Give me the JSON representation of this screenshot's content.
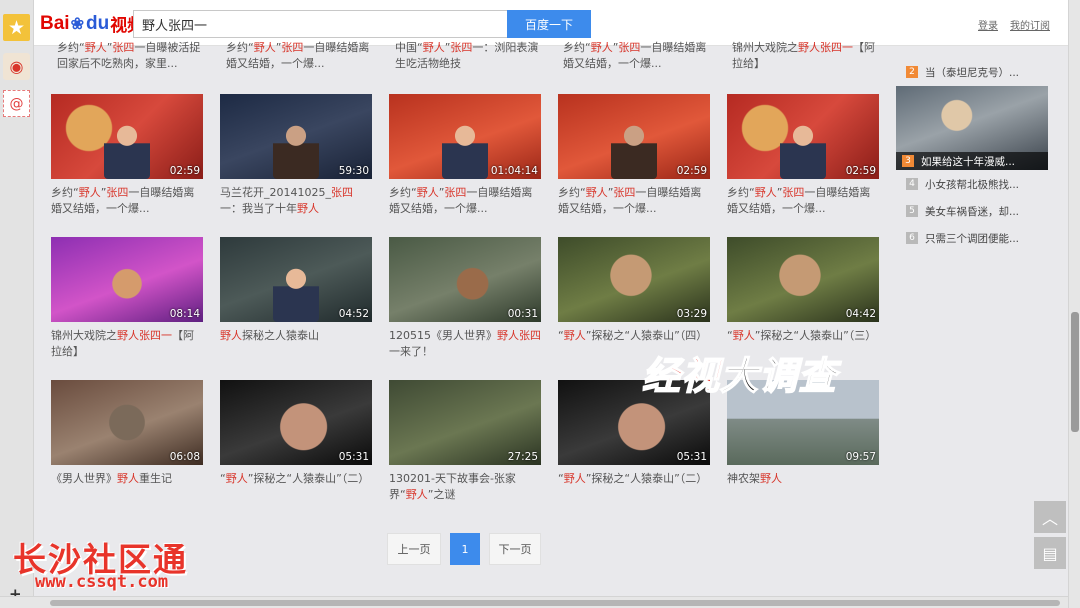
{
  "header": {
    "logo_bai": "Bai",
    "logo_du": "du",
    "logo_video": "视频",
    "search_value": "野人张四一",
    "search_button": "百度一下",
    "login": "登录",
    "subscriptions": "我的订阅"
  },
  "top_strip": [
    {
      "pre": "乡约“",
      "hl": "野人",
      "mid": "”",
      "hl2": "张四",
      "post": "一自曝被活捉回家后不吃熟肉，家里..."
    },
    {
      "pre": "乡约“",
      "hl": "野人",
      "mid": "”",
      "hl2": "张四",
      "post": "一自曝结婚离婚又结婚，一个爆..."
    },
    {
      "pre": "中国“",
      "hl": "野人",
      "mid": "”",
      "hl2": "张四",
      "post": "一：浏阳表演生吃活物绝技"
    },
    {
      "pre": "乡约“",
      "hl": "野人",
      "mid": "”",
      "hl2": "张四",
      "post": "一自曝结婚离婚又结婚，一个爆..."
    },
    {
      "pre": "锦州大戏院之",
      "hl": "野人张四",
      "mid": "",
      "hl2": "一",
      "post": "【阿拉给】"
    }
  ],
  "videos": [
    {
      "duration": "02:59",
      "caption_pre": "乡约“",
      "caption_hl": "野人",
      "caption_mid": "”",
      "caption_hl2": "张四",
      "caption_post": "一自曝结婚离婚又结婚，一个爆..."
    },
    {
      "duration": "59:30",
      "caption_pre": "马兰花开_20141025_",
      "caption_hl": "张四",
      "caption_mid": "一：我当了十年",
      "caption_hl2": "野人",
      "caption_post": ""
    },
    {
      "duration": "01:04:14",
      "caption_pre": "乡约“",
      "caption_hl": "野人",
      "caption_mid": "”",
      "caption_hl2": "张四",
      "caption_post": "一自曝结婚离婚又结婚，一个爆..."
    },
    {
      "duration": "02:59",
      "caption_pre": "乡约“",
      "caption_hl": "野人",
      "caption_mid": "”",
      "caption_hl2": "张四",
      "caption_post": "一自曝结婚离婚又结婚，一个爆..."
    },
    {
      "duration": "02:59",
      "caption_pre": "乡约“",
      "caption_hl": "野人",
      "caption_mid": "”",
      "caption_hl2": "张四",
      "caption_post": "一自曝结婚离婚又结婚，一个爆..."
    },
    {
      "duration": "08:14",
      "caption_pre": "锦州大戏院之",
      "caption_hl": "野人张四",
      "caption_mid": "",
      "caption_hl2": "一",
      "caption_post": "【阿拉给】"
    },
    {
      "duration": "04:52",
      "caption_pre": "",
      "caption_hl": "野人",
      "caption_mid": "探秘之人猿泰山",
      "caption_hl2": "",
      "caption_post": ""
    },
    {
      "duration": "00:31",
      "caption_pre": "120515《男人世界》",
      "caption_hl": "野人",
      "caption_mid": "",
      "caption_hl2": "张四",
      "caption_post": "一来了！"
    },
    {
      "duration": "03:29",
      "caption_pre": "“",
      "caption_hl": "野人",
      "caption_mid": "”探秘之“人猿泰山”（四）",
      "caption_hl2": "",
      "caption_post": ""
    },
    {
      "duration": "04:42",
      "caption_pre": "“",
      "caption_hl": "野人",
      "caption_mid": "”探秘之“人猿泰山”（三）",
      "caption_hl2": "",
      "caption_post": ""
    },
    {
      "duration": "06:08",
      "caption_pre": "《男人世界》",
      "caption_hl": "野人",
      "caption_mid": "重生记",
      "caption_hl2": "",
      "caption_post": ""
    },
    {
      "duration": "05:31",
      "caption_pre": "“",
      "caption_hl": "野人",
      "caption_mid": "”探秘之“人猿泰山”（二）",
      "caption_hl2": "",
      "caption_post": ""
    },
    {
      "duration": "27:25",
      "caption_pre": "130201-天下故事会-张家界“",
      "caption_hl": "野人",
      "caption_mid": "”之谜",
      "caption_hl2": "",
      "caption_post": ""
    },
    {
      "duration": "05:31",
      "caption_pre": "“",
      "caption_hl": "野人",
      "caption_mid": "”探秘之“人猿泰山”（二）",
      "caption_hl2": "",
      "caption_post": ""
    },
    {
      "duration": "09:57",
      "caption_pre": "神农架",
      "caption_hl": "野人",
      "caption_mid": "",
      "caption_hl2": "",
      "caption_post": ""
    }
  ],
  "sidebar": {
    "ranks": [
      {
        "num": "2",
        "text": "当（泰坦尼克号）...",
        "hot": true
      },
      {
        "num": "3",
        "text": "如果给这十年漫威...",
        "hot": true
      },
      {
        "num": "4",
        "text": "小女孩帮北极熊找...",
        "hot": false
      },
      {
        "num": "5",
        "text": "美女车祸昏迷，却...",
        "hot": false
      },
      {
        "num": "6",
        "text": "只需三个调团便能...",
        "hot": false
      }
    ]
  },
  "pagination": {
    "prev": "上一页",
    "current": "1",
    "next": "下一页"
  },
  "watermarks": {
    "show_red": "经视",
    "show_black": "大调查",
    "site_name": "长沙社区通",
    "site_url": "www.cssqt.com"
  },
  "icons": {
    "star": "star-icon",
    "weibo": "weibo-icon",
    "at": "at-icon",
    "plus": "plus-icon",
    "to_top": "chevron-up-icon",
    "feedback": "feedback-icon"
  }
}
